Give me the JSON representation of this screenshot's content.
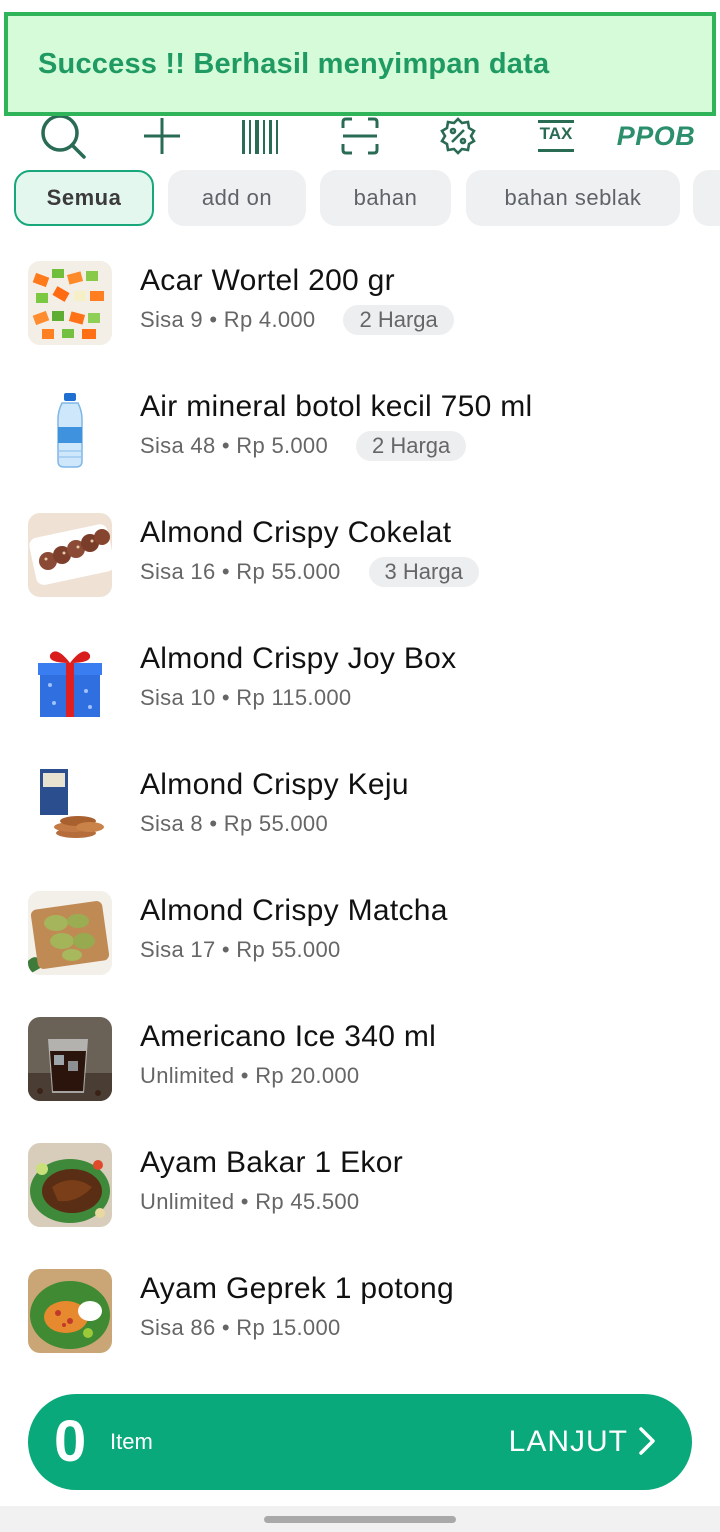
{
  "toast": {
    "message": "Success !! Berhasil menyimpan data"
  },
  "toolbar": {
    "icons": [
      "search-icon",
      "add-icon",
      "barcode-icon",
      "scan-icon",
      "discount-icon",
      "tax-icon",
      "ppob-icon"
    ],
    "tax_label": "TAX",
    "ppob_label": "PPOB"
  },
  "categories": [
    "Semua",
    "add on",
    "bahan",
    "bahan seblak"
  ],
  "products": [
    {
      "name": "Acar Wortel 200 gr",
      "meta": "Sisa 9 • Rp 4.000",
      "badge": "2 Harga"
    },
    {
      "name": "Air mineral botol kecil 750 ml",
      "meta": "Sisa 48 • Rp 5.000",
      "badge": "2 Harga"
    },
    {
      "name": "Almond Crispy Cokelat",
      "meta": "Sisa 16 • Rp 55.000",
      "badge": "3 Harga"
    },
    {
      "name": "Almond Crispy Joy Box",
      "meta": "Sisa 10 • Rp 115.000",
      "badge": ""
    },
    {
      "name": "Almond Crispy Keju",
      "meta": "Sisa 8 • Rp 55.000",
      "badge": ""
    },
    {
      "name": "Almond Crispy Matcha",
      "meta": "Sisa 17 • Rp 55.000",
      "badge": ""
    },
    {
      "name": "Americano Ice 340 ml",
      "meta": "Unlimited • Rp 20.000",
      "badge": ""
    },
    {
      "name": "Ayam Bakar  1 Ekor",
      "meta": "Unlimited • Rp 45.500",
      "badge": ""
    },
    {
      "name": "Ayam Geprek 1 potong",
      "meta": "Sisa 86 • Rp 15.000",
      "badge": ""
    }
  ],
  "cart": {
    "count": "0",
    "item_label": "Item",
    "next_label": "LANJUT"
  },
  "colors": {
    "accent": "#0aa97c",
    "toast_bg": "#d6fbd9",
    "toast_border": "#2fb45a",
    "toast_text": "#1f9a63"
  }
}
